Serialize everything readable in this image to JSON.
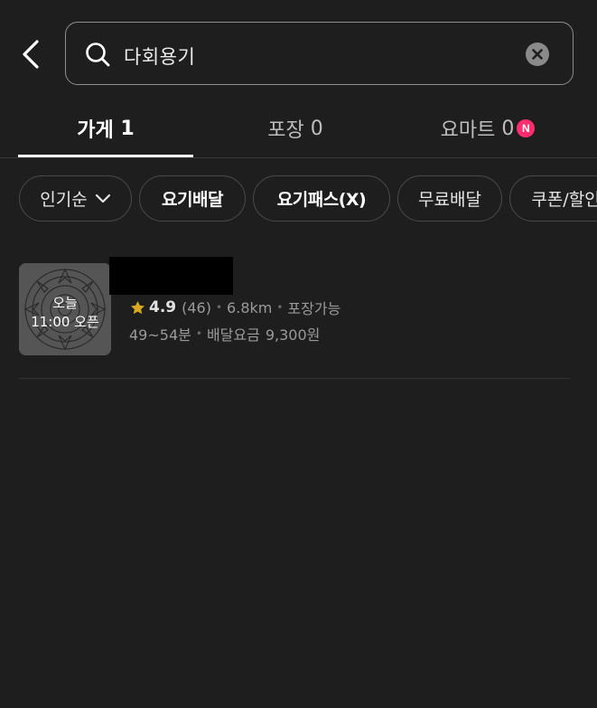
{
  "search": {
    "query": "다회용기"
  },
  "tabs": [
    {
      "label": "가게",
      "count": "1"
    },
    {
      "label": "포장",
      "count": "0"
    },
    {
      "label": "요마트",
      "count": "0",
      "badge": "N"
    }
  ],
  "filters": {
    "sort": "인기순",
    "chips": [
      "요기배달",
      "요기패스(X)",
      "무료배달",
      "쿠폰/할인"
    ]
  },
  "store": {
    "thumb_status_line1": "오늘",
    "thumb_status_line2": "11:00 오픈",
    "rating": "4.9",
    "review_count": "(46)",
    "distance": "6.8km",
    "pickup": "포장가능",
    "delivery_time": "49~54분",
    "delivery_fee_label": "배달요금",
    "delivery_fee": "9,300원"
  },
  "colors": {
    "background": "#1e1e1e",
    "badge": "#ff2d6f",
    "star": "#d9a81e"
  }
}
